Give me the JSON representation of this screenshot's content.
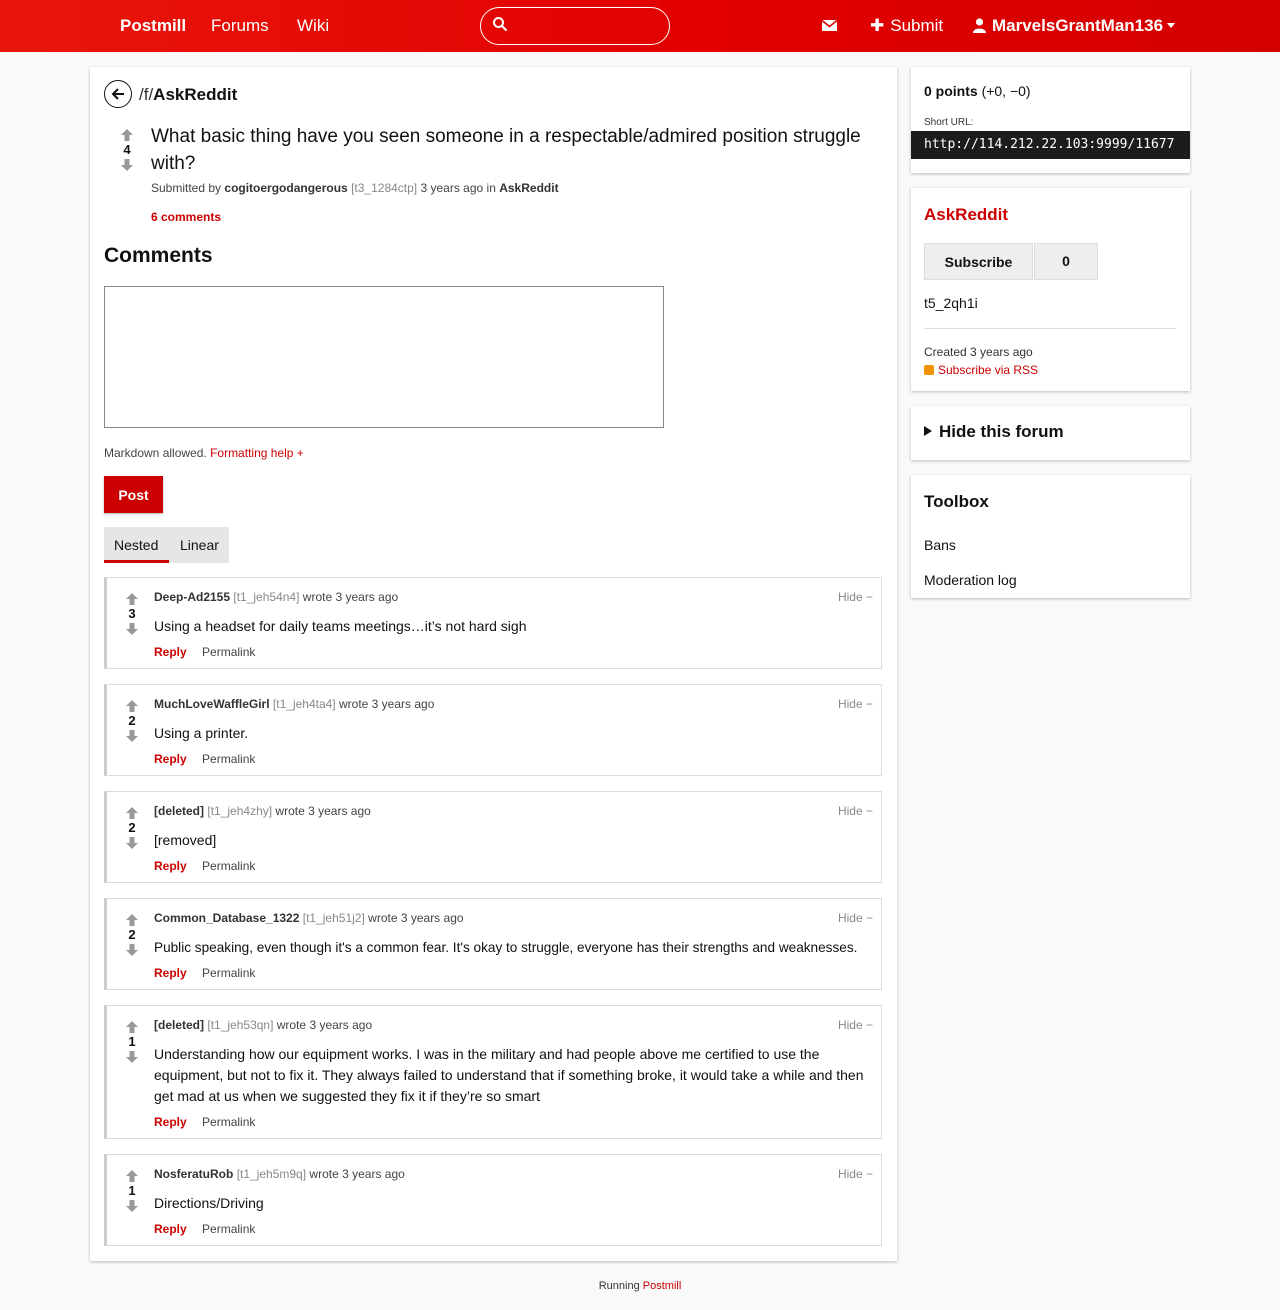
{
  "nav": {
    "brand": "Postmill",
    "forums": "Forums",
    "wiki": "Wiki",
    "search_placeholder": "",
    "submit": "Submit",
    "user": "MarvelsGrantMan136"
  },
  "post": {
    "forum_prefix": "/f/",
    "forum_name": "AskReddit",
    "score": "4",
    "title": "What basic thing have you seen someone in a respectable/admired position struggle with?",
    "submitted_by": "Submitted by",
    "author": "cogitoergodangerous",
    "id": "[t3_1284ctp]",
    "time": "3 years ago in",
    "forum": "AskReddit",
    "comments_link": "6 comments"
  },
  "comment_form": {
    "heading": "Comments",
    "markdown_note": "Markdown allowed.",
    "formatting_help": "Formatting help +",
    "post_button": "Post",
    "tab_nested": "Nested",
    "tab_linear": "Linear"
  },
  "comments": [
    {
      "score": "3",
      "author": "Deep-Ad2155",
      "id": "[t1_jeh54n4]",
      "time": "wrote 3 years ago",
      "hide": "Hide −",
      "body": "Using a headset for daily teams meetings…it’s not hard sigh",
      "reply": "Reply",
      "permalink": "Permalink"
    },
    {
      "score": "2",
      "author": "MuchLoveWaffleGirl",
      "id": "[t1_jeh4ta4]",
      "time": "wrote 3 years ago",
      "hide": "Hide −",
      "body": "Using a printer.",
      "reply": "Reply",
      "permalink": "Permalink"
    },
    {
      "score": "2",
      "author": "[deleted]",
      "id": "[t1_jeh4zhy]",
      "time": "wrote 3 years ago",
      "hide": "Hide −",
      "body": "[removed]",
      "reply": "Reply",
      "permalink": "Permalink"
    },
    {
      "score": "2",
      "author": "Common_Database_1322",
      "id": "[t1_jeh51j2]",
      "time": "wrote 3 years ago",
      "hide": "Hide −",
      "body": "Public speaking, even though it's a common fear. It's okay to struggle, everyone has their strengths and weaknesses.",
      "reply": "Reply",
      "permalink": "Permalink"
    },
    {
      "score": "1",
      "author": "[deleted]",
      "id": "[t1_jeh53qn]",
      "time": "wrote 3 years ago",
      "hide": "Hide −",
      "body": "Understanding how our equipment works. I was in the military and had people above me certified to use the equipment, but not to fix it. They always failed to understand that if something broke, it would take a while and then get mad at us when we suggested they fix it if they’re so smart",
      "reply": "Reply",
      "permalink": "Permalink"
    },
    {
      "score": "1",
      "author": "NosferatuRob",
      "id": "[t1_jeh5m9q]",
      "time": "wrote 3 years ago",
      "hide": "Hide −",
      "body": "Directions/Driving",
      "reply": "Reply",
      "permalink": "Permalink"
    }
  ],
  "sidebar": {
    "points_bold": "0 points",
    "points_detail": "(+0, −0)",
    "short_url_label": "Short URL:",
    "short_url": "http://114.212.22.103:9999/11677",
    "forum_title": "AskReddit",
    "subscribe": "Subscribe",
    "subscriber_count": "0",
    "forum_id": "t5_2qh1i",
    "created": "Created 3 years ago",
    "rss": "Subscribe via RSS",
    "hide_forum": "Hide this forum",
    "toolbox_title": "Toolbox",
    "toolbox_bans": "Bans",
    "toolbox_modlog": "Moderation log"
  },
  "footer": {
    "running": "Running",
    "link": "Postmill"
  },
  "colors": {
    "accent": "#cc0000",
    "nav_bg": "#e20000"
  }
}
